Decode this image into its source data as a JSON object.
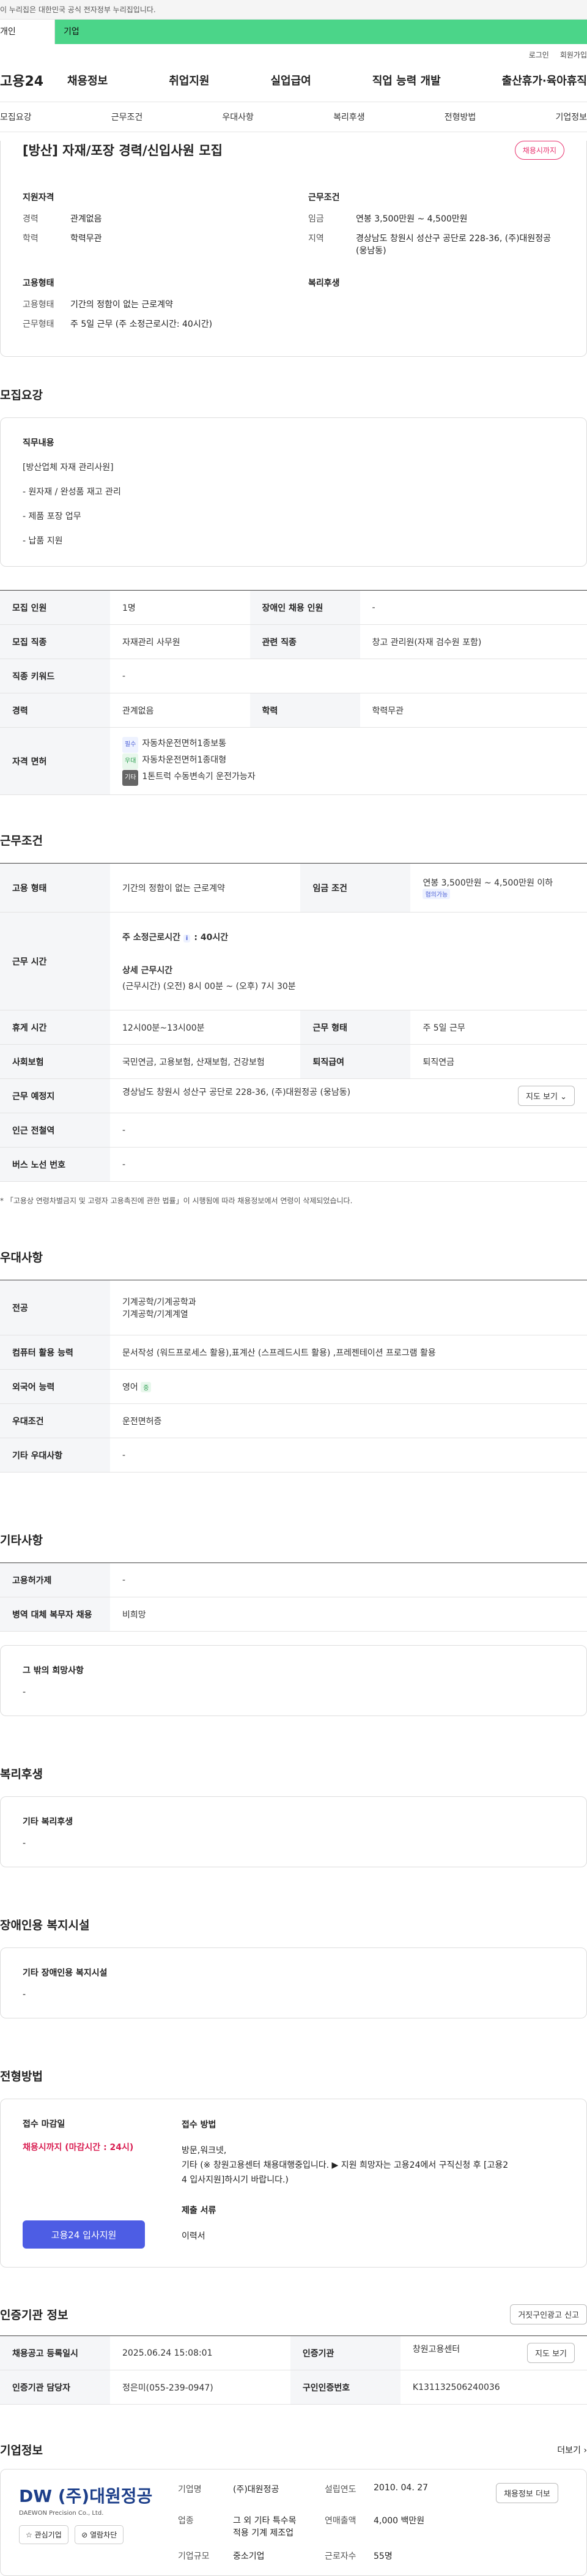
{
  "topbar": {
    "notice": "이 누리집은 대한민국 공식 전자정부 누리집입니다."
  },
  "audience": {
    "tab_a": "개인",
    "tab_b": "기업"
  },
  "util": {
    "login": "로그인",
    "join": "회원가입"
  },
  "gnb": {
    "logo": "고용24",
    "menu": [
      "채용정보",
      "취업지원",
      "실업급여",
      "직업 능력 개발",
      "출산휴가·육아휴직"
    ]
  },
  "subtabs": [
    "모집요강",
    "근무조건",
    "우대사항",
    "복리후생",
    "전형방법",
    "기업정보"
  ],
  "title": {
    "heading": "[방산] 자재/포장 경력/신입사원 모집",
    "badge": "채용시까지"
  },
  "summary": {
    "qual_title": "지원자격",
    "career_k": "경력",
    "career_v": "관계없음",
    "edu_k": "학력",
    "edu_v": "학력무관",
    "work_title": "근무조건",
    "wage_k": "임금",
    "wage_v": "연봉 3,500만원 ~ 4,500만원",
    "loc_k": "지역",
    "loc_v": "경상남도 창원시 성산구 공단로 228-36, (주)대원정공 (웅남동)",
    "emp_title": "고용형태",
    "emptype_k": "고용형태",
    "emptype_v": "기간의 정함이 없는 근로계약",
    "form_k": "근무형태",
    "form_v": "주 5일 근무 (주 소정근로시간: 40시간)",
    "welfare_title": "복리후생"
  },
  "recruit": {
    "section": "모집요강",
    "duty_label": "직무내용",
    "duty_lines": [
      "[방산업체 자재 관리사원]",
      "- 원자재 / 완성품 재고 관리",
      "- 제품 포장 업무",
      "- 납품 지원"
    ],
    "rows": {
      "count_k": "모집 인원",
      "count_v": "1명",
      "disabled_k": "장애인 채용 인원",
      "disabled_v": "-",
      "job_k": "모집 직종",
      "job_v": "자재관리 사무원",
      "rel_k": "관련 직종",
      "rel_v": "창고 관리원(자재 검수원 포함)",
      "kw_k": "직종 키워드",
      "kw_v": "-",
      "career_k": "경력",
      "career_v": "관계없음",
      "edu_k": "학력",
      "edu_v": "학력무관",
      "lic_k": "자격 면허",
      "lic": [
        {
          "tag": "필수",
          "name": "자동차운전면허1종보통"
        },
        {
          "tag": "우대",
          "name": "자동차운전면허1종대형"
        },
        {
          "tag": "기타",
          "name": "1톤트럭 수동변속기 운전가능자"
        }
      ]
    }
  },
  "work": {
    "section": "근무조건",
    "type_k": "고용 형태",
    "type_v": "기간의 정함이 없는 근로계약",
    "wage_k": "임금 조건",
    "wage_v": "연봉 3,500만원 ~ 4,500만원 이하",
    "wage_tag": "협의가능",
    "hours_k": "근무 시간",
    "hours_head": "주 소정근로시간",
    "hours_badge": "i",
    "hours_val": ": 40시간",
    "hours_detail_k": "상세 근무시간",
    "hours_detail_v": "(근무시간) (오전) 8시 00분 ~ (오후) 7시 30분",
    "break_k": "휴게 시간",
    "break_v": "12시00분~13시00분",
    "form_k": "근무 형태",
    "form_v": "주 5일 근무",
    "ins_k": "사회보험",
    "ins_v": "국민연금, 고용보험, 산재보험, 건강보험",
    "ret_k": "퇴직급여",
    "ret_v": "퇴직연금",
    "place_k": "근무 예정지",
    "place_v": "경상남도 창원시 성산구 공단로 228-36, (주)대원정공 (웅남동)",
    "map_btn": "지도 보기",
    "sub_k": "인근 전철역",
    "sub_v": "-",
    "bus_k": "버스 노선 번호",
    "bus_v": "-",
    "note": "* 「고용상 연령차별금지 및 고령자 고용촉진에 관한 법률」이 시행됨에 따라 채용정보에서 연령이 삭제되었습니다."
  },
  "pref": {
    "section": "우대사항",
    "major_k": "전공",
    "major_v1": "기계공학/기계공학과",
    "major_v2": "기계공학/기계계열",
    "pc_k": "컴퓨터 활용 능력",
    "pc_v": "문서작성 (워드프로세스 활용),표계산 (스프레드시트 활용) ,프레젠테이션 프로그램 활용",
    "lang_k": "외국어 능력",
    "lang_v": "영어",
    "lang_tag": "중",
    "cond_k": "우대조건",
    "cond_v": "운전면허증",
    "etc_k": "기타 우대사항",
    "etc_v": "-"
  },
  "other": {
    "section": "기타사항",
    "hire_k": "고용허가제",
    "hire_v": "-",
    "mil_k": "병역 대체 복무자 채용",
    "mil_v": "비희망",
    "wish_label": "그 밖의 희망사항",
    "wish_v": "-"
  },
  "welfare": {
    "section": "복리후생",
    "label": "기타 복리후생",
    "value": "-"
  },
  "disab": {
    "section": "장애인용 복지시설",
    "label": "기타 장애인용 복지시설",
    "value": "-"
  },
  "apply": {
    "section": "전형방법",
    "deadline_label": "접수 마감일",
    "deadline_v": "채용시까지 (마감시간 : 24시)",
    "apply_btn": "고용24 입사지원",
    "method_label": "접수 방법",
    "method_l1": "방문,워크넷,",
    "method_l2": "기타 (※ 창원고용센터 채용대행중입니다. ▶ 지원 희망자는 고용24에서 구직신청 후 [고용2",
    "method_l3": "4 입사지원]하시기 바랍니다.)",
    "doc_label": "제출 서류",
    "doc_v": "이력서"
  },
  "cert": {
    "section": "인증기관 정보",
    "report_btn": "거짓구인광고 신고",
    "reg_k": "채용공고 등록일시",
    "reg_v": "2025.06.24 15:08:01",
    "org_k": "인증기관",
    "org_v": "창원고용센터",
    "map_btn": "지도 보기",
    "mgr_k": "인증기관 담당자",
    "mgr_v": "정은미(055-239-0947)",
    "num_k": "구인인증번호",
    "num_v": "K131132506240036"
  },
  "company": {
    "section": "기업정보",
    "more": "더보기",
    "logo_text": "DW (주)대원정공",
    "logo_sub": "DAEWON Precision Co., Ltd.",
    "fav_btn": "관심기업",
    "follow_btn": "열람차단",
    "name_k": "기업명",
    "name_v": "(주)대원정공",
    "est_k": "설립연도",
    "est_v": "2010. 04. 27",
    "job_btn": "채용정보 더보",
    "ind_k": "업종",
    "ind_v1": "그 외 기타 특수목",
    "ind_v2": "적용 기계 제조업",
    "sales_k": "연매출액",
    "sales_v": "4,000 백만원",
    "emp_k": "근로자수",
    "emp_v": "55명",
    "size_k": "기업규모",
    "size_v": "중소기업"
  }
}
